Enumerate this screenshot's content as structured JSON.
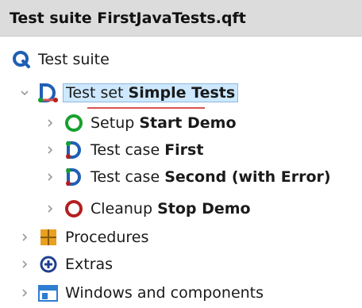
{
  "header": {
    "title": "Test suite FirstJavaTests.qft"
  },
  "tree": {
    "root": {
      "prefix": "Test suite"
    },
    "testset": {
      "prefix": "Test set ",
      "name": "Simple Tests"
    },
    "children": [
      {
        "prefix": "Setup ",
        "name": "Start Demo",
        "icon": "setup-icon"
      },
      {
        "prefix": "Test case ",
        "name": "First",
        "icon": "testcase-icon"
      },
      {
        "prefix": "Test case ",
        "name": "Second (with Error)",
        "icon": "testcase-icon"
      },
      {
        "prefix": "Cleanup ",
        "name": "Stop Demo",
        "icon": "cleanup-icon"
      }
    ],
    "top_items": [
      {
        "label": "Procedures",
        "icon": "procedures-icon"
      },
      {
        "label": "Extras",
        "icon": "extras-icon"
      },
      {
        "label": "Windows and components",
        "icon": "windows-components-icon"
      }
    ]
  },
  "colors": {
    "qf_blue": "#1f5fb4",
    "setup_green": "#16a02e",
    "cleanup_red": "#b51f1f",
    "selection_bg": "#cde8ff",
    "procedures_orange": "#e8a020"
  }
}
